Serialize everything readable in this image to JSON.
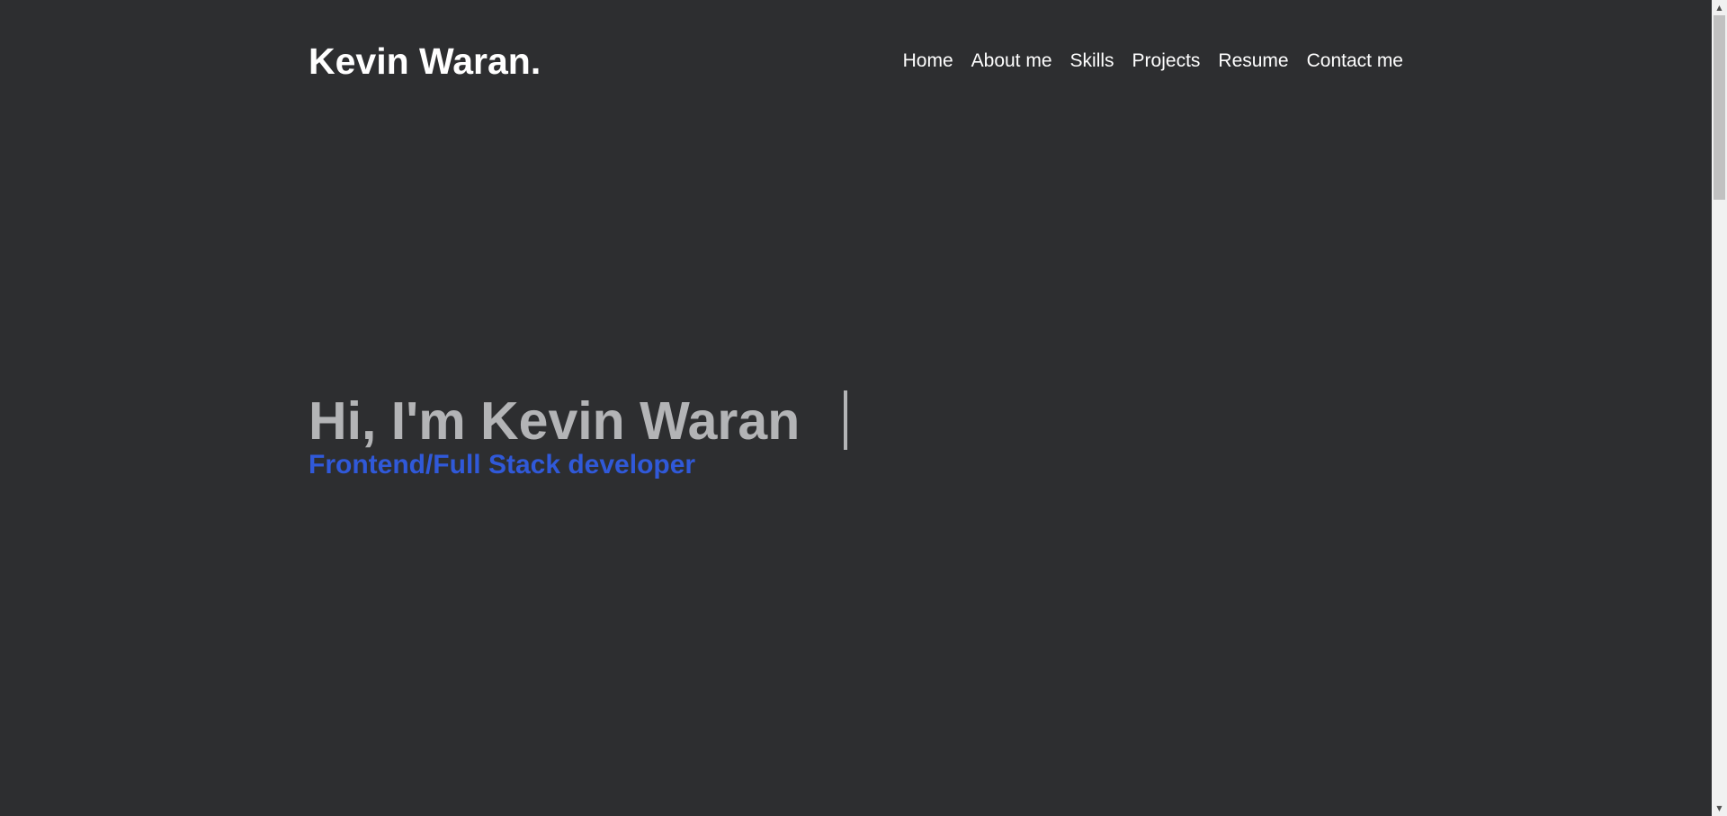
{
  "header": {
    "logo": "Kevin Waran.",
    "nav": [
      {
        "label": "Home"
      },
      {
        "label": "About me"
      },
      {
        "label": "Skills"
      },
      {
        "label": "Projects"
      },
      {
        "label": "Resume"
      },
      {
        "label": "Contact me"
      }
    ]
  },
  "hero": {
    "title": "Hi, I'm Kevin Waran",
    "subtitle": "Frontend/Full Stack developer"
  },
  "scrollbar": {
    "up_icon": "chevron-up-icon",
    "down_icon": "chevron-down-icon"
  },
  "colors": {
    "background": "#2d2e30",
    "heading": "#b3b4b6",
    "accent": "#3059d9",
    "text": "#ffffff"
  }
}
